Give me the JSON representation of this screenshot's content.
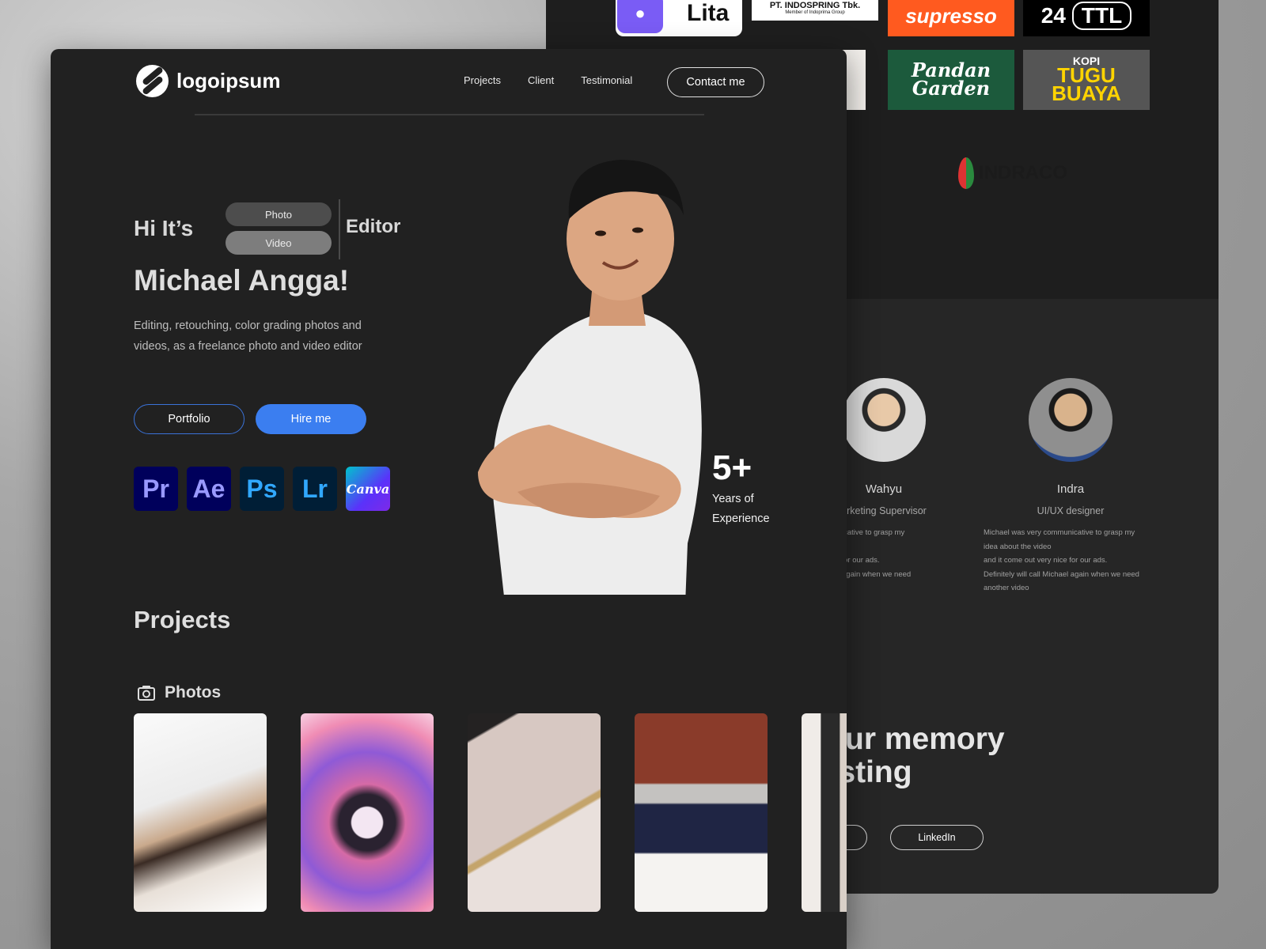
{
  "back": {
    "client_logos": {
      "lita": "Lita",
      "indospring": "PT. INDOSPRING Tbk.",
      "indospring_sub": "Member of Indoprima Group",
      "supresso": "supresso",
      "ttl_num": "24",
      "ttl_text": "TTL",
      "pandan_line1": "Pandan",
      "pandan_line2": "Garden",
      "tugu_top": "KOPI",
      "tugu_line1": "TUGU",
      "tugu_line2": "BUAYA",
      "indraco": "INDRACO"
    },
    "testimonials": [
      {
        "name": "Wahyu",
        "role": "arketing Supervisor",
        "quote": "very communicative to grasp my\nhe video\nout very nice for our ads.\nl call Michael again when we need\no"
      },
      {
        "name": "Indra",
        "role": "UI/UX designer",
        "quote": "Michael was very communicative to grasp my\nidea about the video\nand it come out very nice for our ads.\nDefinitely will call Michael again when we need\nanother video"
      }
    ],
    "headline_line1": "e your memory",
    "headline_line2": "erlasting",
    "linkedin_label": "LinkedIn"
  },
  "nav": {
    "brand": "logoipsum",
    "links": [
      "Projects",
      "Client",
      "Testimonial"
    ],
    "contact_label": "Contact me"
  },
  "hero": {
    "greeting": "Hi It’s",
    "pill_photo": "Photo",
    "pill_video": "Video",
    "role": "Editor",
    "name": "Michael Angga!",
    "description": "Editing, retouching, color grading photos and videos, as a freelance photo and video editor",
    "portfolio_label": "Portfolio",
    "hire_label": "Hire me",
    "tools": [
      "Pr",
      "Ae",
      "Ps",
      "Lr",
      "Canva"
    ],
    "stat_value": "5+",
    "stat_label": "Years of Experience"
  },
  "projects": {
    "title": "Projects",
    "photos_label": "Photos"
  },
  "colors": {
    "accent": "#3b7ef0",
    "background": "#212121"
  }
}
